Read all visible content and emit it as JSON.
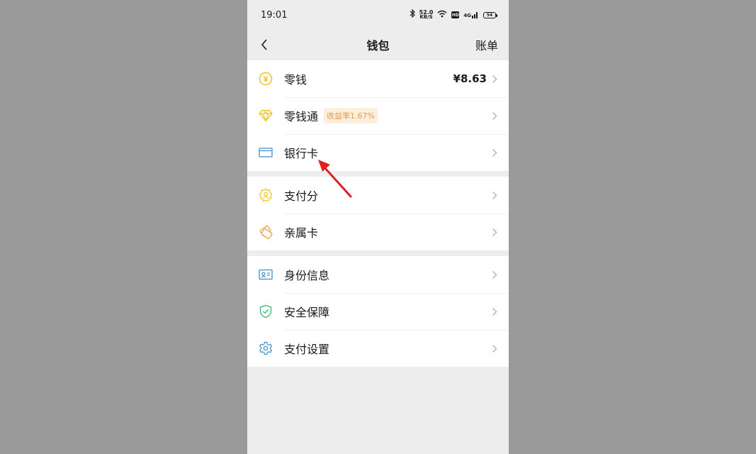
{
  "status_bar": {
    "time": "19:01",
    "net_speed_value": "52.0",
    "net_speed_unit": "KB/S",
    "hd": "HD",
    "signal": "4G",
    "battery": "54"
  },
  "nav": {
    "title": "钱包",
    "right_action": "账单"
  },
  "groups": {
    "g1": [
      {
        "label": "零钱",
        "value": "¥8.63",
        "icon": "yuan-coin-icon"
      },
      {
        "label": "零钱通",
        "badge": "收益率1.67%",
        "icon": "diamond-icon"
      },
      {
        "label": "银行卡",
        "icon": "bank-card-icon"
      }
    ],
    "g2": [
      {
        "label": "支付分",
        "icon": "credit-score-icon"
      },
      {
        "label": "亲属卡",
        "icon": "family-card-icon"
      }
    ],
    "g3": [
      {
        "label": "身份信息",
        "icon": "id-card-icon"
      },
      {
        "label": "安全保障",
        "icon": "shield-check-icon"
      },
      {
        "label": "支付设置",
        "icon": "gear-icon"
      }
    ]
  },
  "colors": {
    "yellow": "#f3c316",
    "blue": "#3d8fd0",
    "orange": "#e8a04a",
    "green": "#2fbf6f",
    "annotation": "#e02020"
  }
}
